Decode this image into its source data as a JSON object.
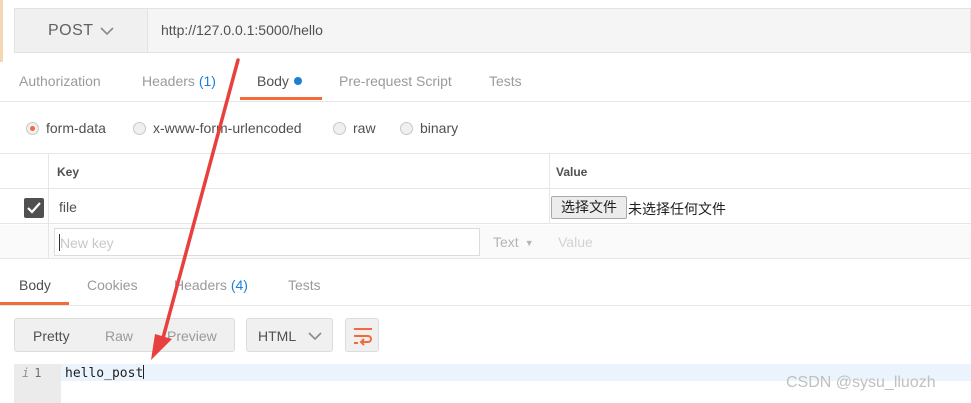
{
  "request": {
    "method": "POST",
    "url": "http://127.0.0.1:5000/hello"
  },
  "request_tabs": [
    {
      "label": "Authorization",
      "count": ""
    },
    {
      "label": "Headers",
      "count": "(1)"
    },
    {
      "label": "Body",
      "count": ""
    },
    {
      "label": "Pre-request Script",
      "count": ""
    },
    {
      "label": "Tests",
      "count": ""
    }
  ],
  "body_types": {
    "form_data": "form-data",
    "urlencoded": "x-www-form-urlencoded",
    "raw": "raw",
    "binary": "binary",
    "selected": "form-data"
  },
  "form_table": {
    "key_header": "Key",
    "value_header": "Value",
    "row": {
      "key": "file",
      "checked": true,
      "file_button": "选择文件",
      "file_status": "未选择任何文件"
    },
    "new_row": {
      "key_placeholder": "New key",
      "type": "Text",
      "value_placeholder": "Value"
    }
  },
  "response_tabs": [
    {
      "label": "Body",
      "count": ""
    },
    {
      "label": "Cookies",
      "count": ""
    },
    {
      "label": "Headers",
      "count": "(4)"
    },
    {
      "label": "Tests",
      "count": ""
    }
  ],
  "response_view": {
    "modes": [
      "Pretty",
      "Raw",
      "Preview"
    ],
    "active_mode": "Pretty",
    "format": "HTML"
  },
  "code": {
    "line_number": "1",
    "line_icon": "i",
    "text": "hello_post"
  },
  "watermark": "CSDN @sysu_lluozh",
  "colors": {
    "accent": "#f26b3a",
    "count_blue": "#1b7fd6",
    "annotation_arrow": "#e8403e"
  }
}
